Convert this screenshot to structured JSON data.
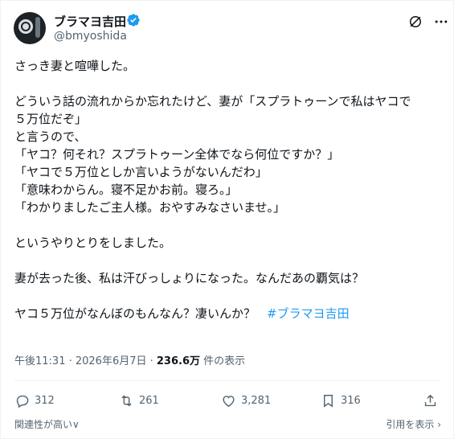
{
  "author": {
    "display_name": "ブラマヨ吉田",
    "handle": "@bmyoshida"
  },
  "tweet": {
    "lines": [
      "さっき妻と喧嘩した。",
      "",
      "どういう話の流れからか忘れたけど、妻が「スプラトゥーンで私はヤコで",
      "５万位だぞ」",
      "と言うので、",
      "「ヤコ？何それ？スプラトゥーン全体でなら何位ですか？」",
      "「ヤコで５万位としか言いようがないんだわ」",
      "「意味わからん。寝不足かお前。寝ろ。」",
      "「わかりましたご主人様。おやすみなさいませ。」",
      "",
      "というやりとりをしました。",
      "",
      "妻が去った後、私は汗びっしょりになった。なんだあの覇気は？",
      ""
    ],
    "last_line": "ヤコ５万位がなんぼのもんなん？凄いんか？",
    "hashtag": "#ブラマヨ吉田"
  },
  "meta": {
    "time": "午後11:31 · 2026年6月7日 · ",
    "views_count": "236.6万",
    "views_suffix": " 件の表示"
  },
  "actions": {
    "replies": "312",
    "reposts": "261",
    "likes": "3,281",
    "bookmarks": "316"
  },
  "footer": {
    "sort_label": "関連性が高い∨",
    "quotes_label": "引用を表示 ›"
  },
  "colors": {
    "accent": "#1d9bf0",
    "text": "#0f1419",
    "muted": "#536471"
  },
  "icons": [
    "verified-badge-icon",
    "grok-icon",
    "more-icon",
    "reply-icon",
    "repost-icon",
    "like-icon",
    "bookmark-icon",
    "share-icon"
  ]
}
